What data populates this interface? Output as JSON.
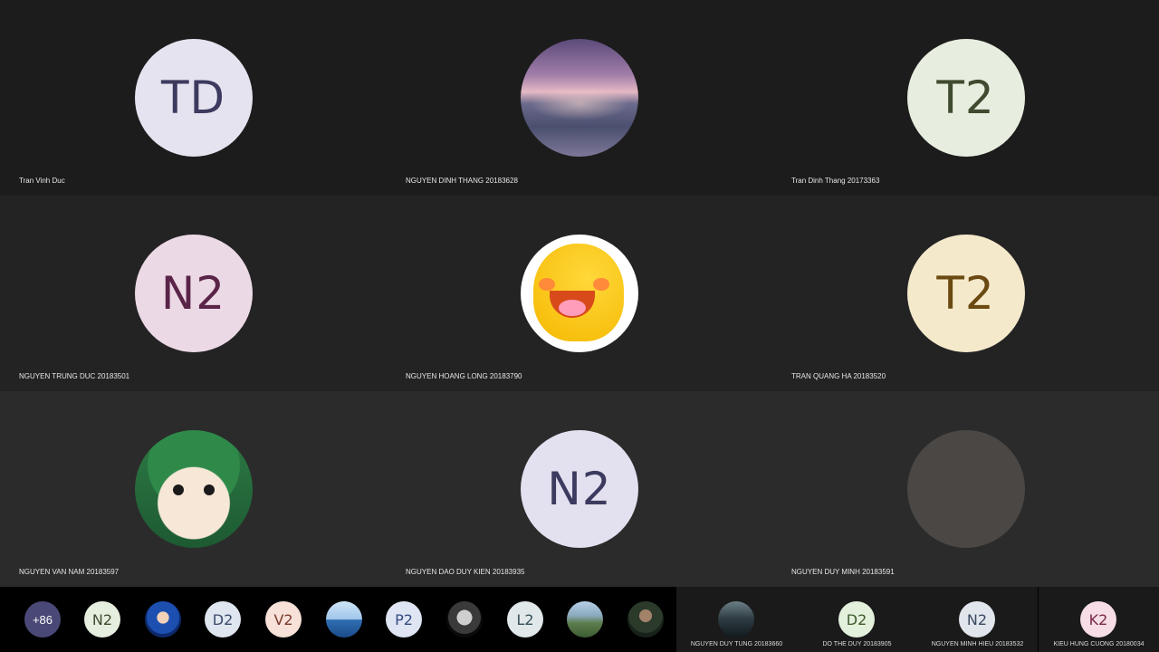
{
  "tiles": [
    {
      "initials": "TD",
      "name": "Tran Vinh Duc",
      "bg": "#e6e3f0",
      "fg": "#3c3a5e"
    },
    {
      "initials": "",
      "name": "NGUYEN DINH THANG 20183628",
      "avatar": "sunset-sea-photo"
    },
    {
      "initials": "T2",
      "name": "Tran Dinh Thang 20173363",
      "bg": "#e7eedf",
      "fg": "#3f4a2f"
    },
    {
      "initials": "N2",
      "name": "NGUYEN TRUNG DUC 20183501",
      "bg": "#ecd9e6",
      "fg": "#5a2448"
    },
    {
      "initials": "",
      "name": "NGUYEN HOANG LONG 20183790",
      "avatar": "yellow-emoji-sticker"
    },
    {
      "initials": "T2",
      "name": "TRAN QUANG HA 20183520",
      "bg": "#f5e9cc",
      "fg": "#6a4a12"
    },
    {
      "initials": "",
      "name": "NGUYEN VAN NAM 20183597",
      "avatar": "cat-in-hood-photo"
    },
    {
      "initials": "N2",
      "name": "NGUYEN DAO DUY KIEN 20183935",
      "bg": "#e3e0ef",
      "fg": "#3c3a5e"
    },
    {
      "initials": "",
      "name": "NGUYEN DUY MINH 20183591",
      "avatar": "blank-avatar"
    }
  ],
  "strip": {
    "more": "+86",
    "items": [
      {
        "initials": "N2",
        "bg": "#e6eedf",
        "fg": "#3f4a2f"
      },
      {
        "initials": "",
        "photo": "blue"
      },
      {
        "initials": "D2",
        "bg": "#dfe6f0",
        "fg": "#3a4a6a"
      },
      {
        "initials": "V2",
        "bg": "#f7e1d9",
        "fg": "#7a3a2a"
      },
      {
        "initials": "",
        "photo": "sky"
      },
      {
        "initials": "P2",
        "bg": "#dfe5f3",
        "fg": "#344a80"
      },
      {
        "initials": "",
        "photo": "bw"
      },
      {
        "initials": "L2",
        "bg": "#e0e8ea",
        "fg": "#355058"
      },
      {
        "initials": "",
        "photo": "mt"
      },
      {
        "initials": "",
        "photo": "dk"
      }
    ],
    "featured": [
      {
        "initials": "",
        "photo": "car",
        "name": "NGUYEN DUY TUNG 20183660"
      },
      {
        "initials": "D2",
        "bg": "#e3f0dc",
        "fg": "#3f5a2f",
        "name": "DO THE DUY 20183905"
      },
      {
        "initials": "N2",
        "bg": "#e1e5ec",
        "fg": "#3a4a62",
        "name": "NGUYEN MINH HIEU 20183532"
      },
      {
        "initials": "K2",
        "bg": "#f6dde6",
        "fg": "#7a2848",
        "name": "KIEU HUNG CUONG 20180034"
      }
    ]
  }
}
